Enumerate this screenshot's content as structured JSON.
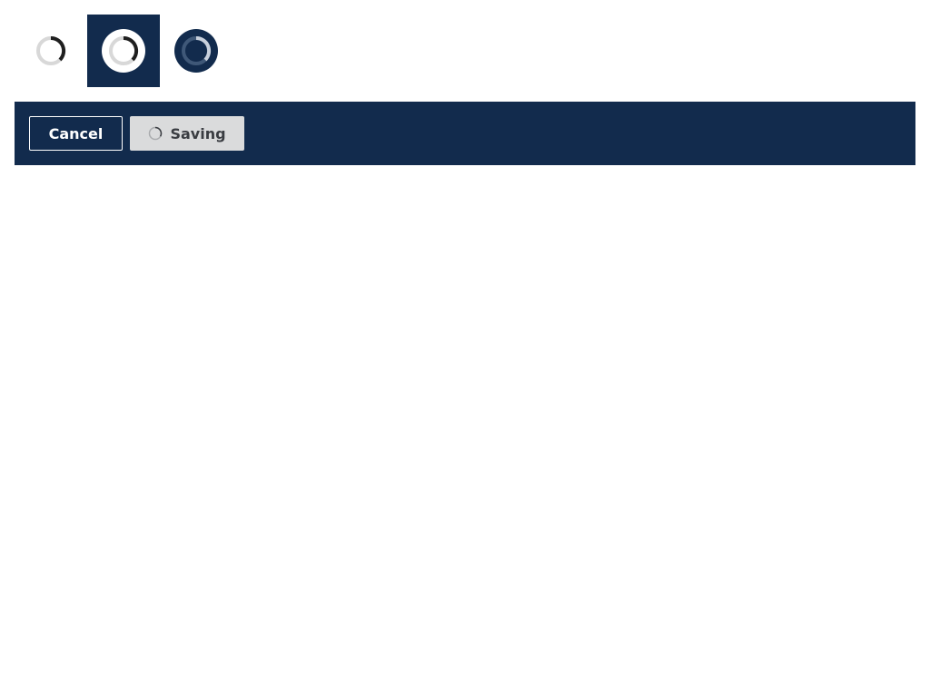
{
  "spinners": [
    {
      "icon": "loading-spinner-icon",
      "variant": "light",
      "background": "none"
    },
    {
      "icon": "loading-spinner-icon",
      "variant": "light-inverted",
      "background": "dark"
    },
    {
      "icon": "loading-spinner-icon",
      "variant": "dark",
      "background": "none"
    }
  ],
  "button_bar": {
    "cancel_label": "Cancel",
    "saving_label": "Saving",
    "saving_icon": "loading-spinner-icon"
  },
  "colors": {
    "navy": "#122b4d",
    "disabled_button": "#dadbdc",
    "disabled_text": "#3a3d42",
    "spinner_track_light": "#d8d8d8",
    "spinner_arc_dark": "#1f1f1f"
  }
}
